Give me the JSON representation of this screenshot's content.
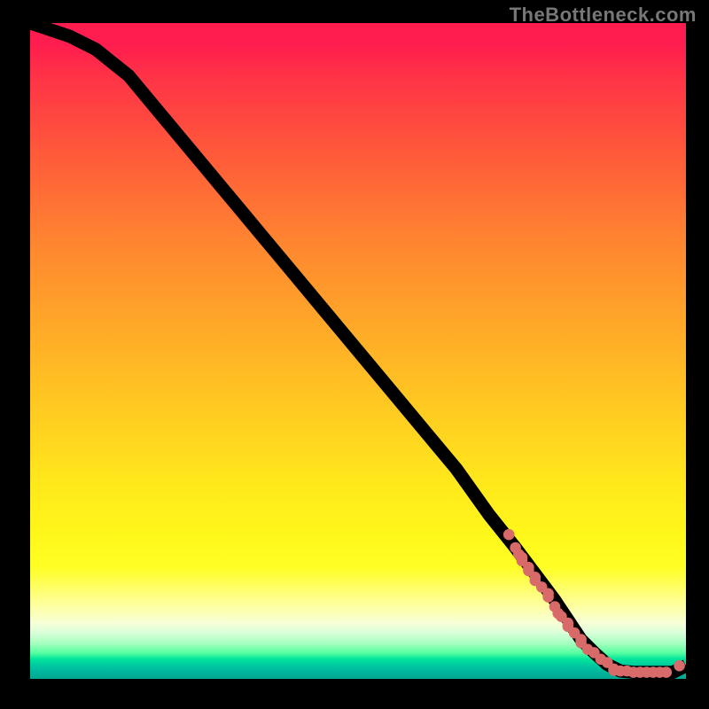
{
  "watermark": "TheBottleneck.com",
  "chart_data": {
    "type": "line",
    "title": "",
    "xlabel": "",
    "ylabel": "",
    "xlim": [
      0,
      100
    ],
    "ylim": [
      0,
      100
    ],
    "grid": false,
    "legend": false,
    "series": [
      {
        "name": "curve",
        "x": [
          0,
          3,
          6,
          10,
          15,
          20,
          25,
          30,
          35,
          40,
          45,
          50,
          55,
          60,
          65,
          70,
          74,
          77,
          80,
          82,
          84,
          86,
          88,
          90,
          92,
          94,
          96,
          98,
          100
        ],
        "values": [
          100,
          99,
          98,
          96,
          92,
          86,
          80,
          74,
          68,
          62,
          56,
          50,
          44,
          38,
          32,
          25,
          20,
          16,
          12,
          9,
          6,
          4,
          2.2,
          1.2,
          1.0,
          1.0,
          1.0,
          1.0,
          2.0
        ]
      }
    ],
    "points": {
      "name": "cluster",
      "color": "#d86a6a",
      "x": [
        73,
        74,
        74.5,
        75,
        75,
        76,
        76,
        77,
        77,
        78,
        79,
        79,
        80,
        80.5,
        81,
        82,
        82,
        83,
        84,
        84,
        85,
        86,
        87,
        88,
        89,
        89,
        90,
        91,
        92,
        93,
        94,
        95,
        96,
        97,
        99
      ],
      "values": [
        22,
        20,
        19,
        18.5,
        18,
        17,
        16.5,
        15.5,
        15,
        14,
        13,
        12.5,
        11,
        10,
        9.5,
        8.5,
        8,
        7,
        6,
        5.5,
        4.5,
        4,
        3,
        2.5,
        1.5,
        1.3,
        1.2,
        1.2,
        1.0,
        1.0,
        1.0,
        1.0,
        1.0,
        1.0,
        2.0
      ]
    }
  }
}
